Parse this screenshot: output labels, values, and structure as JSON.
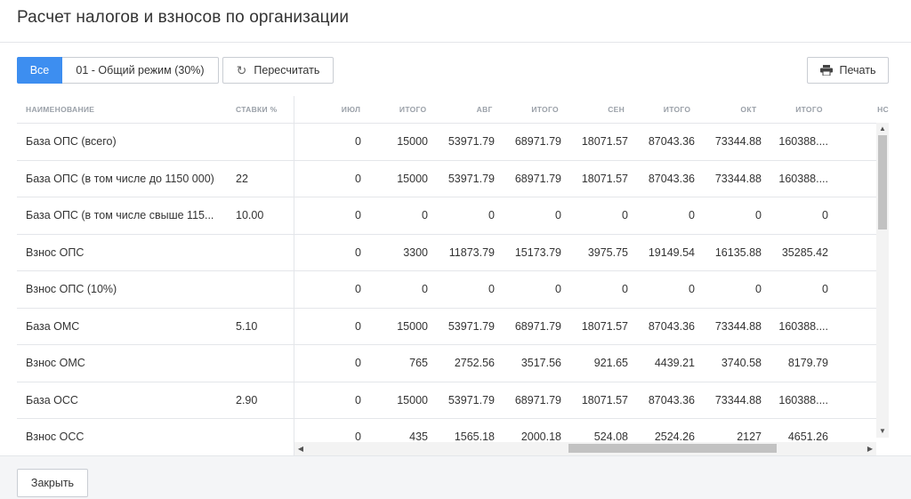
{
  "title": "Расчет налогов и взносов по организации",
  "toolbar": {
    "all_label": "Все",
    "mode_label": "01 - Общий режим (30%)",
    "recalc_label": "Пересчитать",
    "print_label": "Печать"
  },
  "table": {
    "headers": {
      "name": "НАИМЕНОВАНИЕ",
      "rate": "СТАВКИ %",
      "cols": [
        "ИЮЛ",
        "ИТОГО",
        "АВГ",
        "ИТОГО",
        "СЕН",
        "ИТОГО",
        "ОКТ",
        "ИТОГО",
        "НС"
      ]
    },
    "rows": [
      {
        "name": "База ОПС (всего)",
        "rate": "",
        "values": [
          "0",
          "15000",
          "53971.79",
          "68971.79",
          "18071.57",
          "87043.36",
          "73344.88",
          "160388...."
        ]
      },
      {
        "name": "База ОПС (в том числе до 1150 000)",
        "rate": "22",
        "values": [
          "0",
          "15000",
          "53971.79",
          "68971.79",
          "18071.57",
          "87043.36",
          "73344.88",
          "160388...."
        ]
      },
      {
        "name": "База ОПС (в том числе свыше 115...",
        "rate": "10.00",
        "values": [
          "0",
          "0",
          "0",
          "0",
          "0",
          "0",
          "0",
          "0"
        ]
      },
      {
        "name": "Взнос ОПС",
        "rate": "",
        "values": [
          "0",
          "3300",
          "11873.79",
          "15173.79",
          "3975.75",
          "19149.54",
          "16135.88",
          "35285.42"
        ]
      },
      {
        "name": "Взнос ОПС (10%)",
        "rate": "",
        "values": [
          "0",
          "0",
          "0",
          "0",
          "0",
          "0",
          "0",
          "0"
        ]
      },
      {
        "name": "База ОМС",
        "rate": "5.10",
        "values": [
          "0",
          "15000",
          "53971.79",
          "68971.79",
          "18071.57",
          "87043.36",
          "73344.88",
          "160388...."
        ]
      },
      {
        "name": "Взнос ОМС",
        "rate": "",
        "values": [
          "0",
          "765",
          "2752.56",
          "3517.56",
          "921.65",
          "4439.21",
          "3740.58",
          "8179.79"
        ]
      },
      {
        "name": "База ОСС",
        "rate": "2.90",
        "values": [
          "0",
          "15000",
          "53971.79",
          "68971.79",
          "18071.57",
          "87043.36",
          "73344.88",
          "160388...."
        ]
      },
      {
        "name": "Взнос ОСС",
        "rate": "",
        "values": [
          "0",
          "435",
          "1565.18",
          "2000.18",
          "524.08",
          "2524.26",
          "2127",
          "4651.26"
        ]
      }
    ]
  },
  "footer": {
    "close_label": "Закрыть"
  },
  "icons": {
    "recalc": "refresh-icon",
    "print": "printer-icon"
  },
  "colors": {
    "accent": "#3d8ef0"
  }
}
